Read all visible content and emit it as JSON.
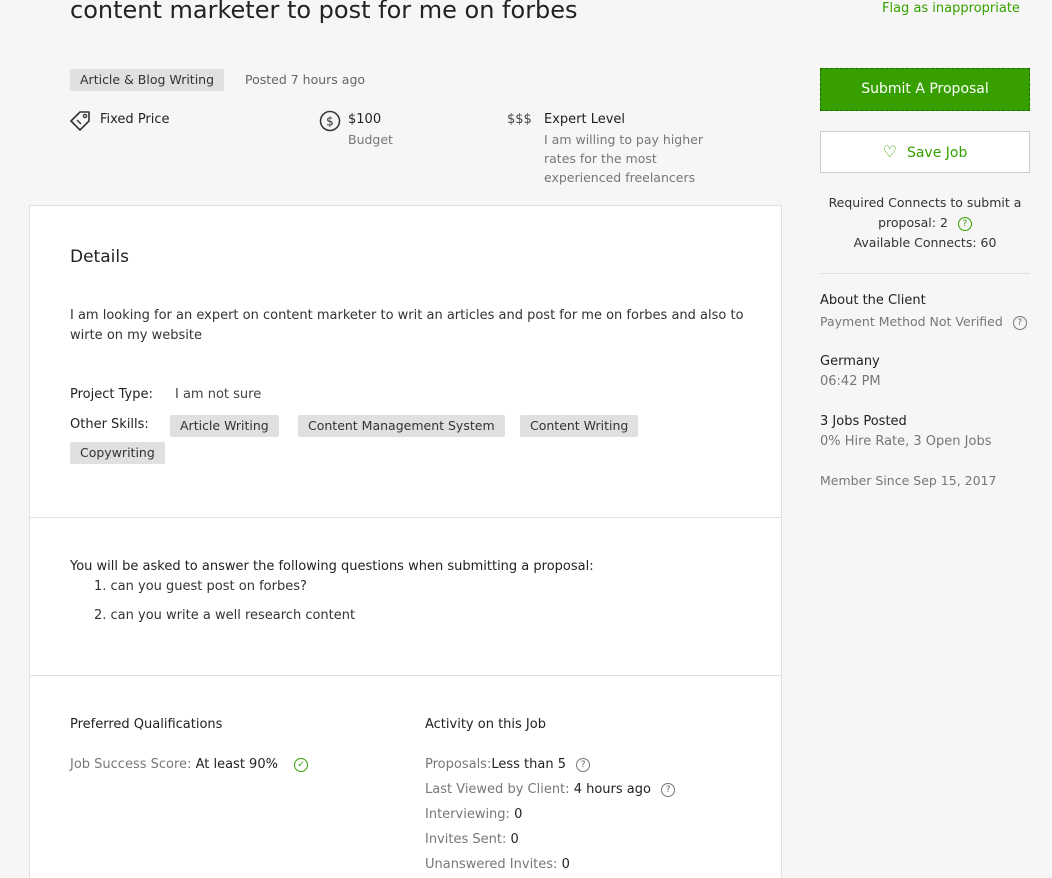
{
  "job": {
    "title": "content marketer to post for me on forbes",
    "flag_label": "Flag as inappropriate",
    "category": "Article & Blog Writing",
    "posted": "Posted 7 hours ago",
    "price_type": "Fixed Price",
    "budget_value": "$100",
    "budget_label": "Budget",
    "level_symbol": "$$$",
    "level_label": "Expert Level",
    "level_desc": "I am willing to pay higher rates for the most experienced freelancers"
  },
  "details": {
    "heading": "Details",
    "description": "I am looking for an expert on content marketer to writ an articles and post for me on forbes and also to wirte on my website",
    "project_type_label": "Project Type:",
    "project_type_value": "I am not sure",
    "skills_label": "Other Skills:",
    "skills": [
      "Article Writing",
      "Content Management System",
      "Content Writing",
      "Copywriting"
    ]
  },
  "questions": {
    "intro": "You will be asked to answer the following questions when submitting a proposal:",
    "items": [
      "1. can you guest post on forbes?",
      "2. can you write a well research content"
    ]
  },
  "qualifications": {
    "heading": "Preferred Qualifications",
    "jss_label": "Job Success Score:",
    "jss_value": "At least 90%"
  },
  "activity": {
    "heading": "Activity on this Job",
    "proposals_label": "Proposals:",
    "proposals_value": "Less than 5",
    "last_viewed_label": "Last Viewed by Client:",
    "last_viewed_value": "4 hours ago",
    "interviewing_label": "Interviewing:",
    "interviewing_value": "0",
    "invites_label": "Invites Sent:",
    "invites_value": "0",
    "unanswered_label": "Unanswered Invites:",
    "unanswered_value": "0"
  },
  "sidebar": {
    "submit_label": "Submit A Proposal",
    "save_label": "Save Job",
    "connects_required": "Required Connects to submit a proposal: 2",
    "connects_available": "Available Connects: 60",
    "about_heading": "About the Client",
    "payment_status": "Payment Method Not Verified",
    "country": "Germany",
    "local_time": "06:42 PM",
    "jobs_posted": "3 Jobs Posted",
    "hire_rate": "0% Hire Rate, 3 Open Jobs",
    "member_since": "Member Since Sep 15, 2017"
  },
  "icons": {
    "price_tag": "price-tag-icon",
    "dollar": "dollar-circle-icon",
    "heart": "heart-icon",
    "help": "question-mark-icon",
    "check": "check-circle-icon"
  },
  "colors": {
    "accent": "#37a000",
    "badge_bg": "#e0e0e0"
  }
}
